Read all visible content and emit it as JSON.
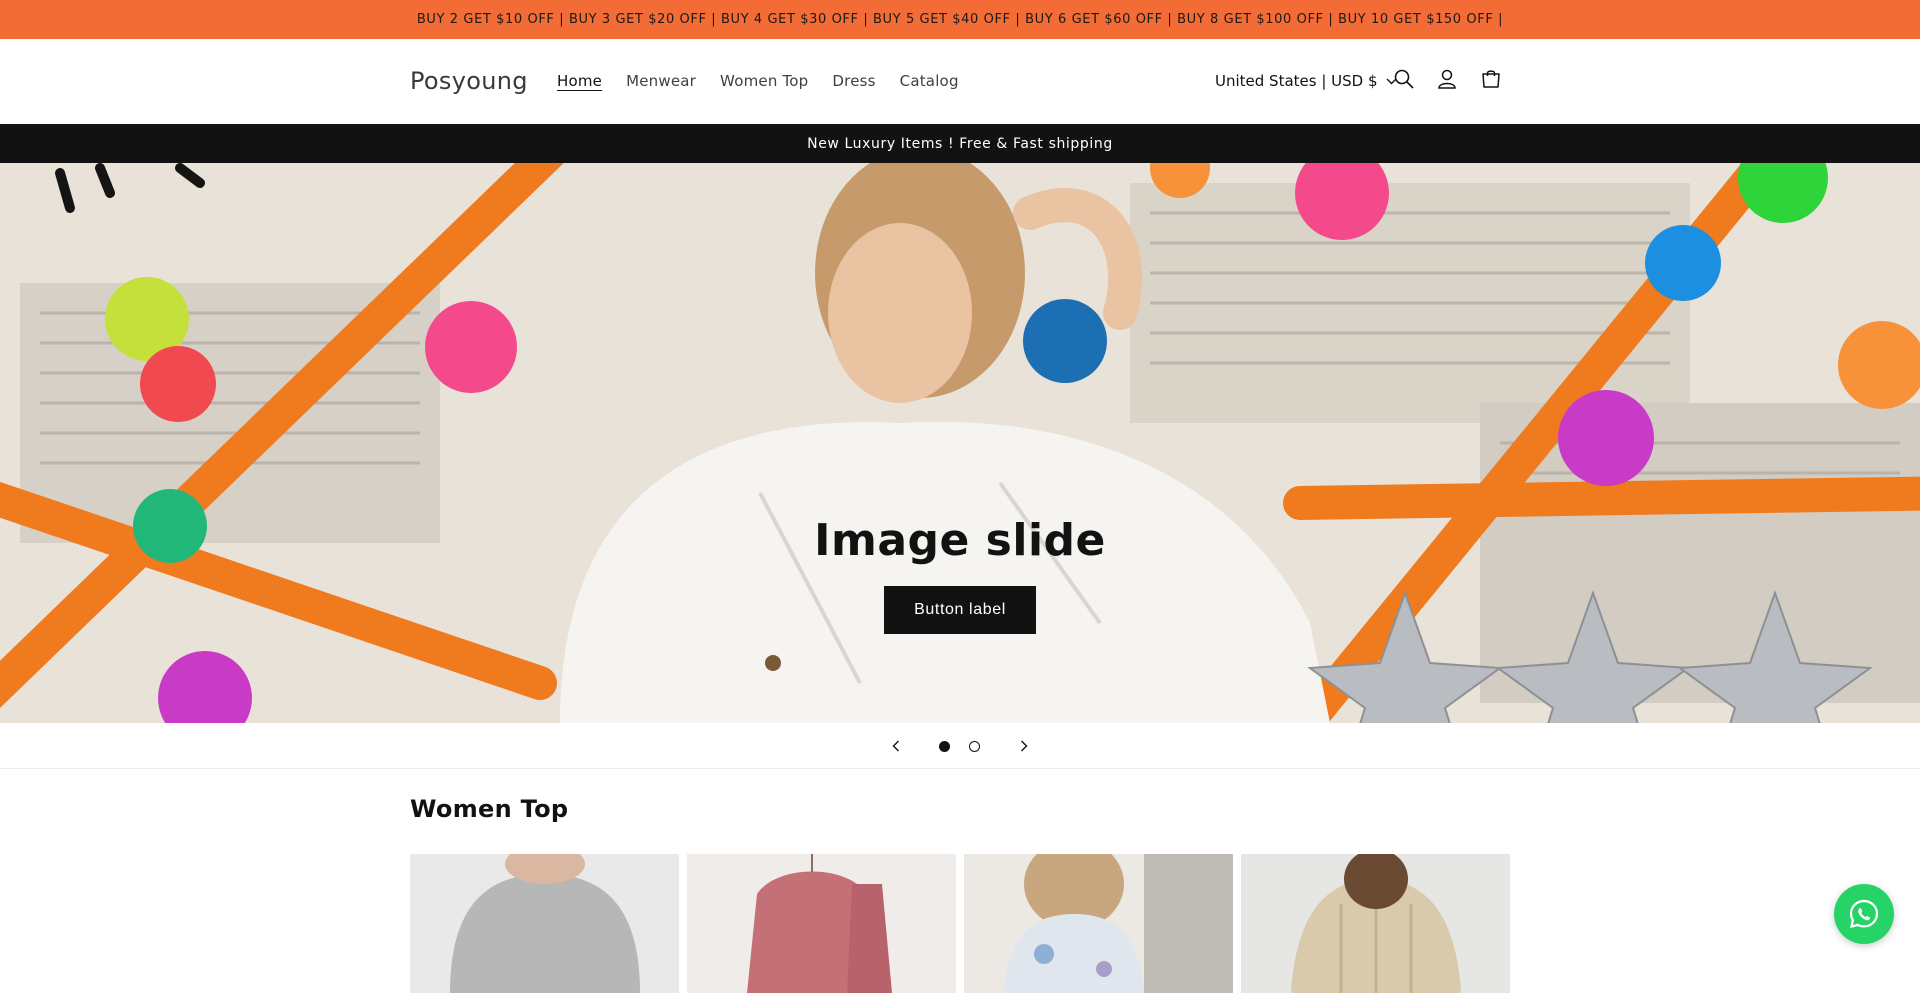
{
  "promo": {
    "text": "BUY 2 GET $10 OFF | BUY 3 GET $20 OFF | BUY 4 GET $30 OFF | BUY 5 GET $40 OFF | BUY 6 GET $60 OFF | BUY 8 GET $100 OFF | BUY 10 GET $150 OFF |"
  },
  "header": {
    "logo": "Posyoung",
    "nav": [
      "Home",
      "Menwear",
      "Women Top",
      "Dress",
      "Catalog"
    ],
    "active_nav": "Home",
    "country": "United States | USD $",
    "icons": [
      "search-icon",
      "account-icon",
      "cart-icon"
    ]
  },
  "shipping_bar": {
    "text": "New Luxury Items ! Free & Fast shipping"
  },
  "hero": {
    "title": "Image slide",
    "button_label": "Button label",
    "slide_count": 2,
    "current_slide": 1
  },
  "section": {
    "title": "Women Top",
    "products": [
      {
        "name": "grey-knit-top",
        "color": "#bdbdbd"
      },
      {
        "name": "pink-velvet-hoodie-set",
        "color": "#c9787a"
      },
      {
        "name": "floral-jacket",
        "color": "#dfe4ea"
      },
      {
        "name": "cream-cable-hoodie",
        "color": "#d7c9ad"
      }
    ]
  },
  "colors": {
    "promo_bg": "#f36b35",
    "dark": "#121212",
    "whatsapp": "#25d366"
  }
}
